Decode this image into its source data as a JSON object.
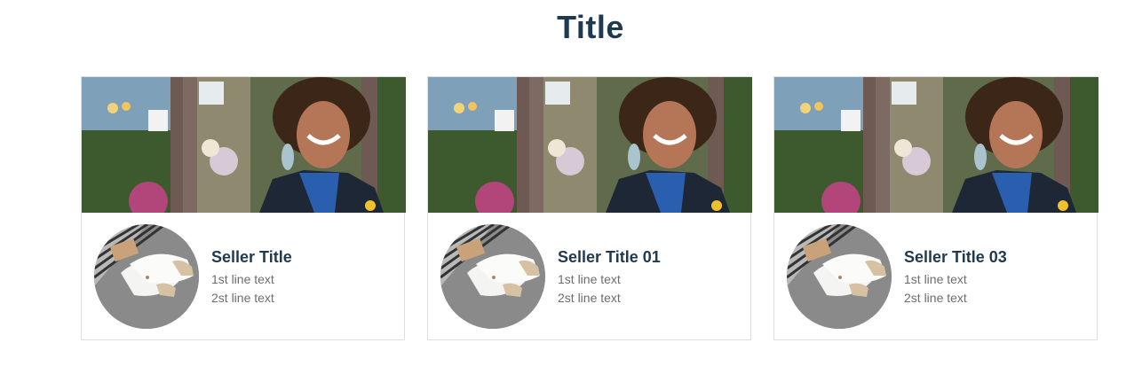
{
  "page": {
    "title": "Title"
  },
  "cards": [
    {
      "seller_title": "Seller Title",
      "line1": "1st line text",
      "line2": "2st line text"
    },
    {
      "seller_title": "Seller Title 01",
      "line1": "1st line text",
      "line2": "2st line text"
    },
    {
      "seller_title": "Seller Title 03",
      "line1": "1st line text",
      "line2": "2st line text"
    }
  ],
  "icons": {
    "banner": "woman-smiling-storefront-photo",
    "avatar": "white-sneakers-photo"
  }
}
